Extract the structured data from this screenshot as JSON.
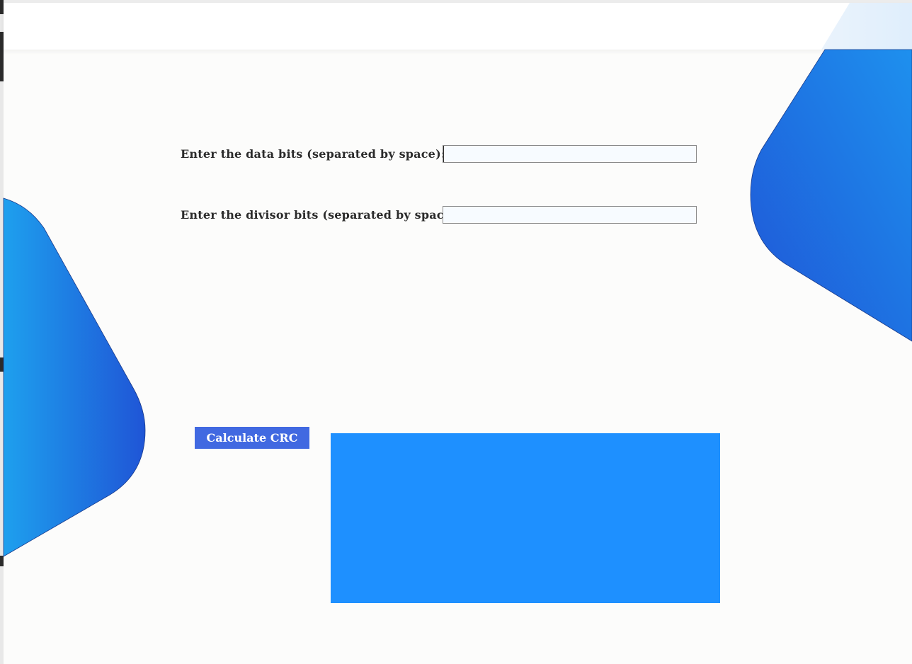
{
  "form": {
    "data_bits_label": "Enter the data bits (separated by space):",
    "data_bits_value": "",
    "divisor_bits_label": "Enter the divisor bits (separated by space):",
    "divisor_bits_value": ""
  },
  "actions": {
    "calculate_label": "Calculate CRC"
  },
  "result": {
    "text": ""
  },
  "colors": {
    "button": "#4169e1",
    "result_panel": "#1e90ff",
    "decor_light": "#1ea0ee",
    "decor_dark": "#1f55d6"
  }
}
